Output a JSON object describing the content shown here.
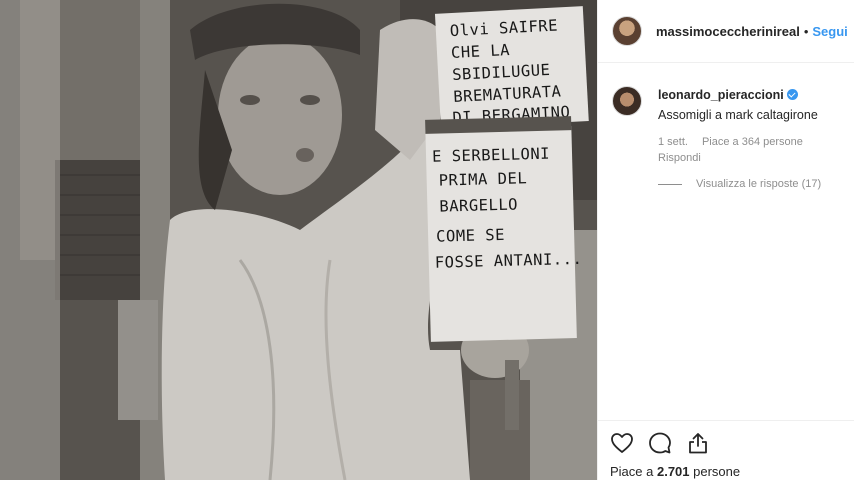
{
  "post": {
    "username": "massimoceccherinireal",
    "separator": "•",
    "follow_label": "Segui",
    "sign_lines": [
      "Olvi SAIFRE",
      "CHE LA",
      "SBIDILUGUE",
      "BREMATURATA",
      "DI BERGAMINO",
      "E SERBELLONI",
      "PRIMA DEL",
      "BARGELLO",
      "COME SE",
      "FOSSE ANTANI..."
    ]
  },
  "comment": {
    "username": "leonardo_pieraccioni",
    "text": "Assomigli a mark caltagirone",
    "time": "1 sett.",
    "likes": "Piace a 364 persone",
    "reply_label": "Rispondi",
    "view_replies": "Visualizza le risposte (17)"
  },
  "footer": {
    "likes_prefix": "Piace a ",
    "likes_count": "2.701",
    "likes_suffix": " persone"
  },
  "icons": [
    "heart-icon",
    "comment-icon",
    "share-icon",
    "verified-badge-icon"
  ],
  "colors": {
    "accent": "#3897f0",
    "text": "#262626",
    "muted": "#8e8e8e",
    "border": "#efefef"
  }
}
